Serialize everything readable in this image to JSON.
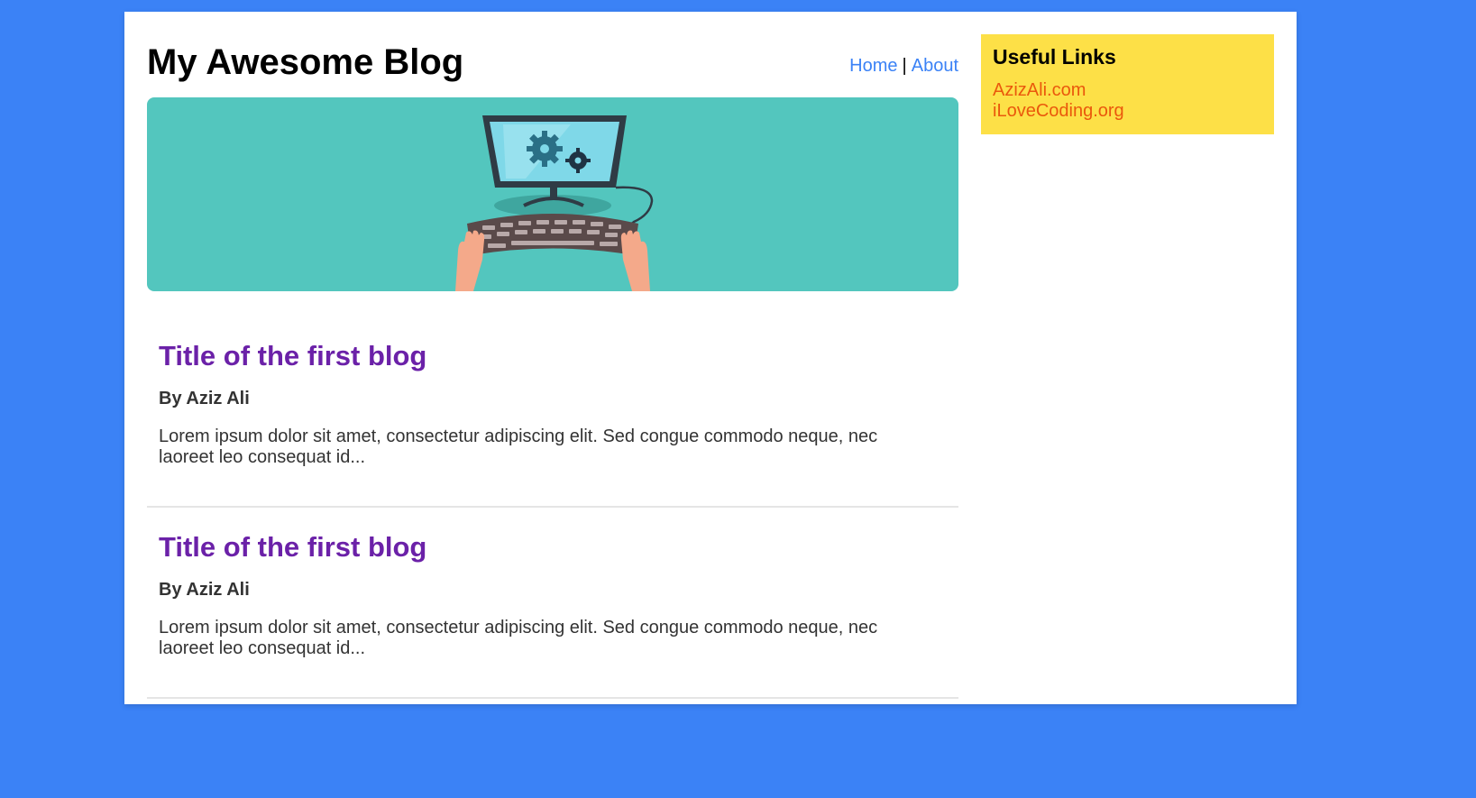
{
  "header": {
    "title": "My Awesome Blog",
    "nav": {
      "home": "Home",
      "separator": "|",
      "about": "About"
    }
  },
  "hero": {
    "image": "computer-keyboard-illustration",
    "background_color": "#53c6be"
  },
  "posts": [
    {
      "title": "Title of the first blog",
      "author": "By Aziz Ali",
      "excerpt": "Lorem ipsum dolor sit amet, consectetur adipiscing elit. Sed congue commodo neque, nec laoreet leo consequat id..."
    },
    {
      "title": "Title of the first blog",
      "author": "By Aziz Ali",
      "excerpt": "Lorem ipsum dolor sit amet, consectetur adipiscing elit. Sed congue commodo neque, nec laoreet leo consequat id..."
    }
  ],
  "sidebar": {
    "title": "Useful Links",
    "links": [
      "AzizAli.com",
      "iLoveCoding.org"
    ]
  },
  "colors": {
    "page_background": "#3b82f6",
    "nav_link": "#3b82f6",
    "post_title": "#6b21a8",
    "sidebar_background": "#fde047",
    "sidebar_link": "#ea580c"
  }
}
